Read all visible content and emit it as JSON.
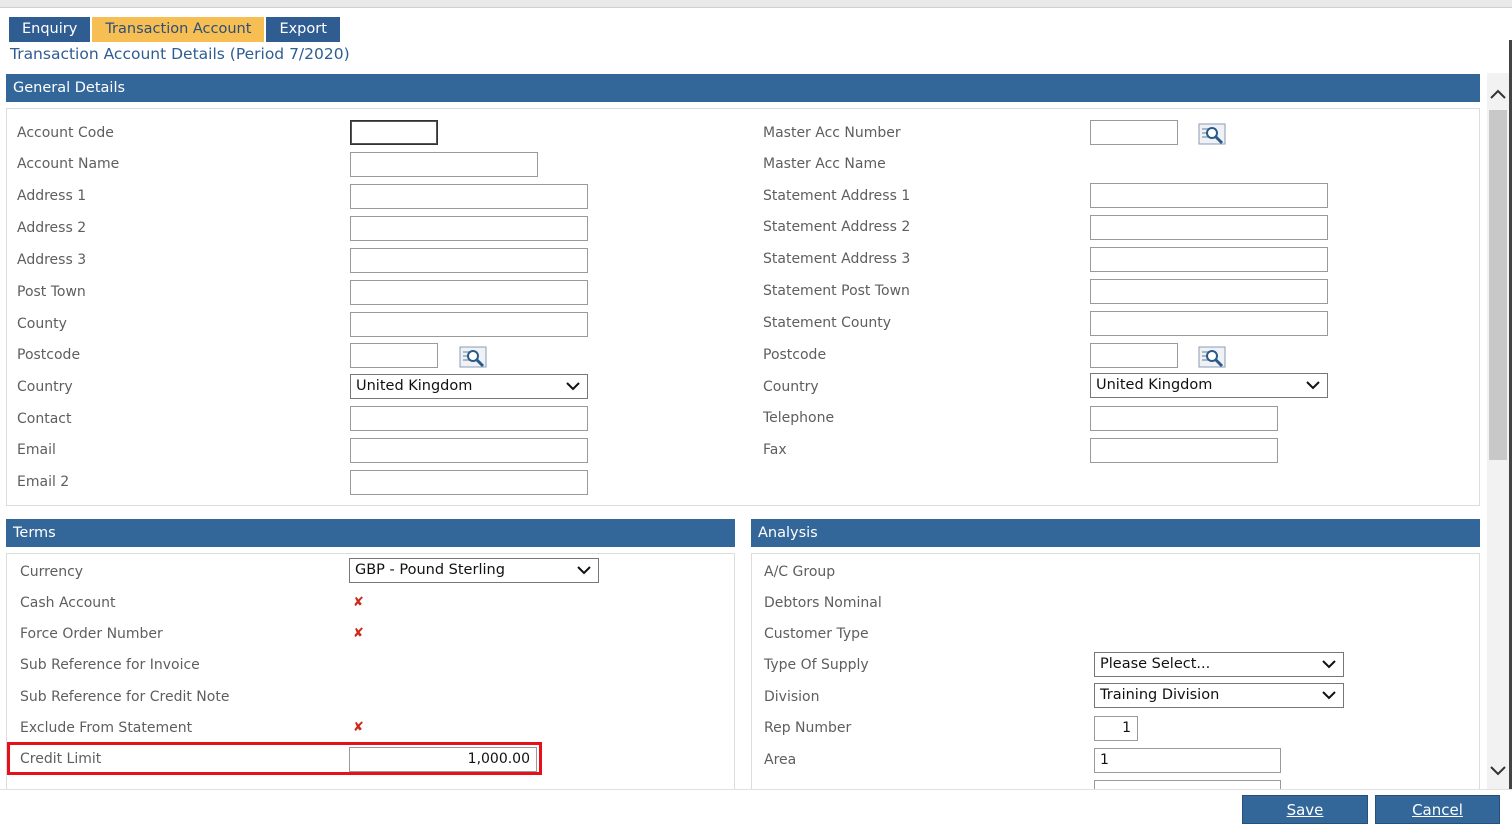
{
  "tabs": [
    {
      "label": "Enquiry",
      "active": false
    },
    {
      "label": "Transaction Account",
      "active": true
    },
    {
      "label": "Export",
      "active": false
    }
  ],
  "page_title": "Transaction Account Details (Period 7/2020)",
  "general": {
    "title": "General Details",
    "left": {
      "account_code": {
        "label": "Account Code",
        "value": ""
      },
      "account_name": {
        "label": "Account Name",
        "value": ""
      },
      "address1": {
        "label": "Address 1",
        "value": ""
      },
      "address2": {
        "label": "Address 2",
        "value": ""
      },
      "address3": {
        "label": "Address 3",
        "value": ""
      },
      "post_town": {
        "label": "Post Town",
        "value": ""
      },
      "county": {
        "label": "County",
        "value": ""
      },
      "postcode": {
        "label": "Postcode",
        "value": ""
      },
      "country": {
        "label": "Country",
        "value": "United Kingdom"
      },
      "contact": {
        "label": "Contact",
        "value": ""
      },
      "email": {
        "label": "Email",
        "value": ""
      },
      "email2": {
        "label": "Email 2",
        "value": ""
      }
    },
    "right": {
      "master_acc_number": {
        "label": "Master Acc Number",
        "value": ""
      },
      "master_acc_name": {
        "label": "Master Acc Name"
      },
      "stmt_address1": {
        "label": "Statement Address 1",
        "value": ""
      },
      "stmt_address2": {
        "label": "Statement Address 2",
        "value": ""
      },
      "stmt_address3": {
        "label": "Statement Address 3",
        "value": ""
      },
      "stmt_post_town": {
        "label": "Statement Post Town",
        "value": ""
      },
      "stmt_county": {
        "label": "Statement County",
        "value": ""
      },
      "postcode": {
        "label": "Postcode",
        "value": ""
      },
      "country": {
        "label": "Country",
        "value": "United Kingdom"
      },
      "telephone": {
        "label": "Telephone",
        "value": ""
      },
      "fax": {
        "label": "Fax",
        "value": ""
      }
    }
  },
  "terms": {
    "title": "Terms",
    "currency": {
      "label": "Currency",
      "value": "GBP - Pound Sterling"
    },
    "cash_account": {
      "label": "Cash Account",
      "mark": "✘"
    },
    "force_order_number": {
      "label": "Force Order Number",
      "mark": "✘"
    },
    "sub_ref_invoice": {
      "label": "Sub Reference for Invoice"
    },
    "sub_ref_credit": {
      "label": "Sub Reference for Credit Note"
    },
    "exclude_statement": {
      "label": "Exclude From Statement",
      "mark": "✘"
    },
    "credit_limit": {
      "label": "Credit Limit",
      "value": "1,000.00"
    }
  },
  "analysis": {
    "title": "Analysis",
    "ac_group": {
      "label": "A/C Group"
    },
    "debtors_nominal": {
      "label": "Debtors Nominal"
    },
    "customer_type": {
      "label": "Customer Type"
    },
    "type_of_supply": {
      "label": "Type Of Supply",
      "value": "Please Select..."
    },
    "division": {
      "label": "Division",
      "value": "Training Division"
    },
    "rep_number": {
      "label": "Rep Number",
      "value": "1"
    },
    "area": {
      "label": "Area",
      "value": "1"
    }
  },
  "buttons": {
    "save": "Save",
    "cancel": "Cancel"
  },
  "icons": {
    "lookup": "magnifier-lookup-icon",
    "dropdown": "chevron-down-icon",
    "cross": "cross-mark-icon"
  },
  "colors": {
    "header_blue": "#336699",
    "active_tab": "#f7be53",
    "highlight": "#e6101a",
    "cross": "#cc2a1a"
  }
}
